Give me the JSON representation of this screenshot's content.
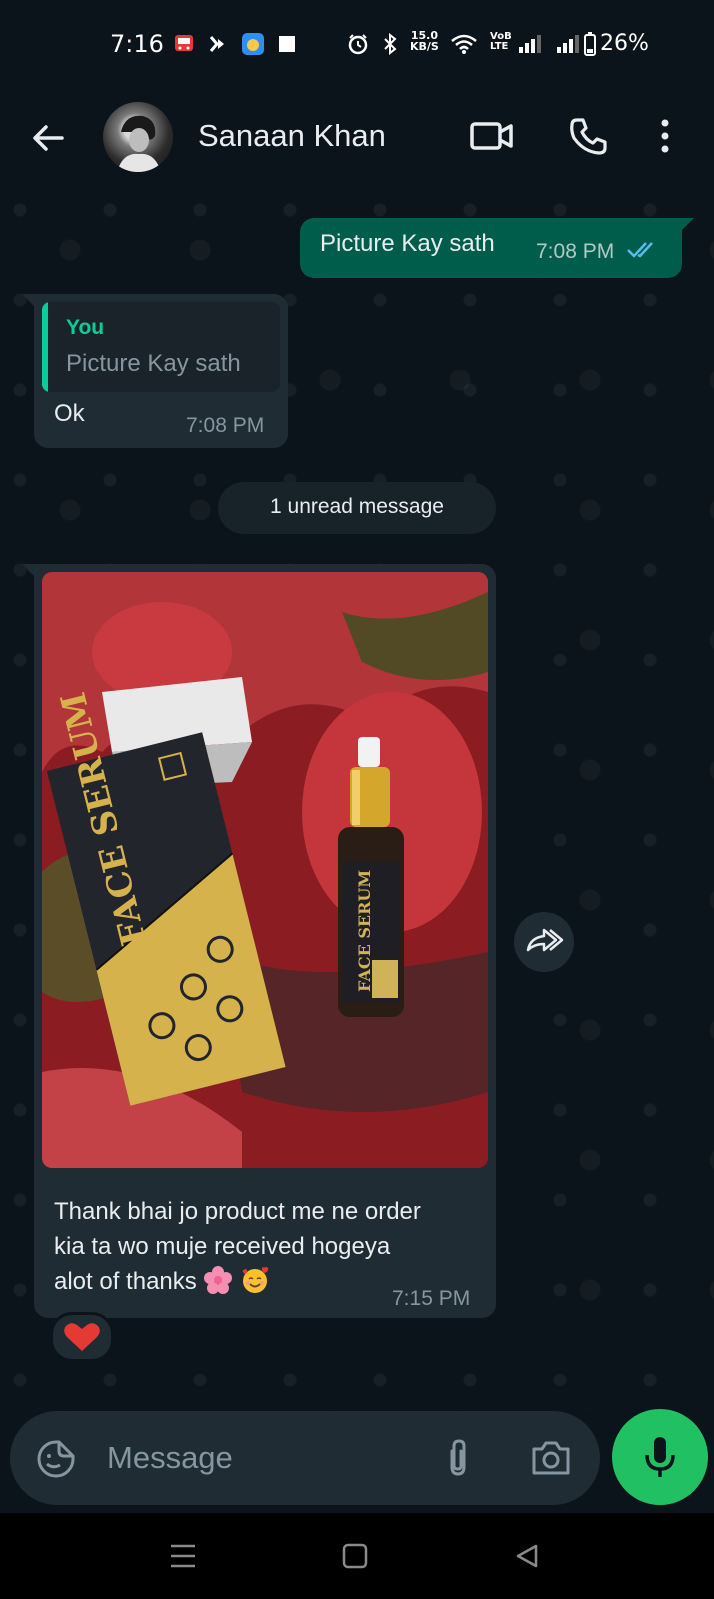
{
  "status_bar": {
    "time": "7:16",
    "net_speed_value": "15.0",
    "net_speed_unit": "KB/S",
    "network_badge_top": "VoB",
    "network_badge_bottom": "LTE",
    "battery": "26%"
  },
  "header": {
    "contact_name": "Sanaan Khan",
    "icons": [
      "back-arrow-icon",
      "video-call-icon",
      "voice-call-icon",
      "more-options-icon"
    ]
  },
  "messages": {
    "outgoing": {
      "text": "Picture Kay sath",
      "time": "7:08 PM",
      "status": "read"
    },
    "incoming_reply": {
      "quote_author": "You",
      "quote_text": "Picture Kay sath",
      "text": "Ok",
      "time": "7:08 PM"
    },
    "unread_divider": "1 unread message",
    "incoming_photo": {
      "box_label": "FACE SERUM",
      "bottle_label": "FACE SERUM",
      "caption_line1": "Thank bhai jo product me ne order",
      "caption_line2": "kia ta wo muje received hogeya",
      "caption_line3": "alot of thanks",
      "time": "7:15 PM",
      "reaction": "heart"
    }
  },
  "input_bar": {
    "placeholder": "Message"
  },
  "colors": {
    "background": "#0b141a",
    "outgoing_bubble": "#005c4b",
    "incoming_bubble": "#202c33",
    "accent_green": "#21c063",
    "read_tick": "#53bdeb"
  }
}
